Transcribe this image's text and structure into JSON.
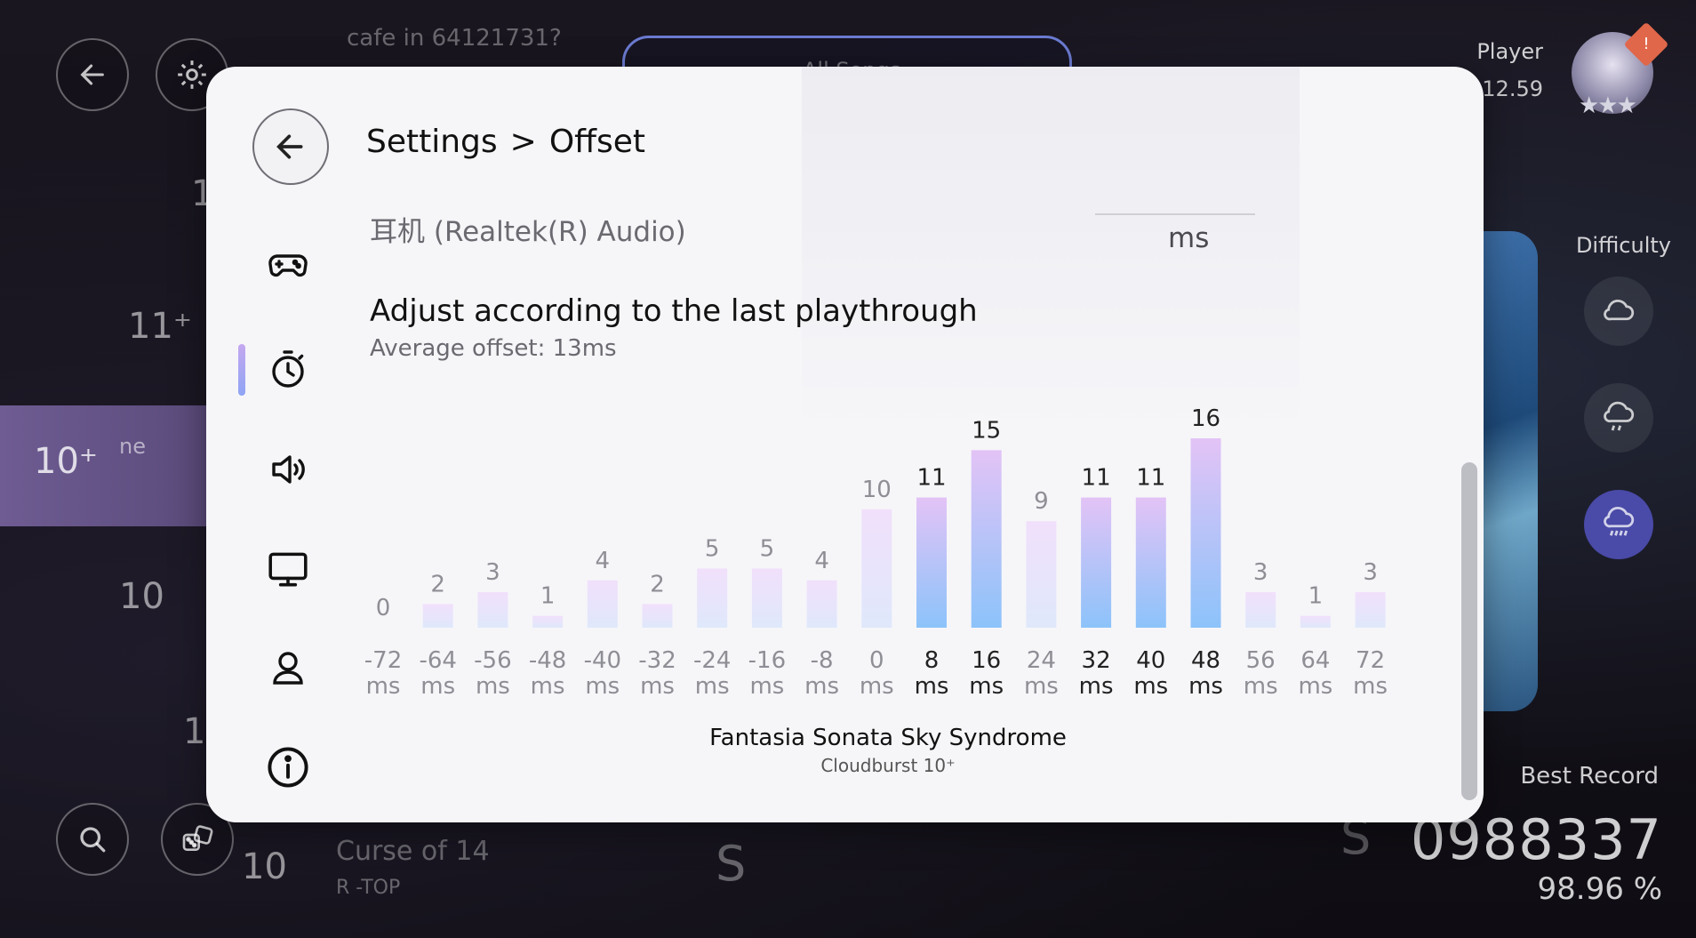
{
  "background": {
    "song_header_text": "cafe in 64121731?",
    "pill_label": "All Songs",
    "level_labels": [
      "1",
      "11⁺",
      "10⁺",
      "10",
      "1",
      "10"
    ],
    "list_item_text": "ne",
    "bottom_song_title": "Curse of 14",
    "bottom_song_sub": "R -TOP",
    "s_marks": [
      "S",
      "S"
    ]
  },
  "player": {
    "name": "Player",
    "rks": "12.59",
    "badge": "!",
    "stars": "★★★"
  },
  "difficulty": {
    "label": "Difficulty",
    "icons": [
      "cloud-icon",
      "cloud-drizzle-icon",
      "cloud-rain-icon"
    ],
    "active_index": 2
  },
  "best_record": {
    "label": "Best Record",
    "score": "0988337",
    "accuracy": "98.96 %"
  },
  "modal": {
    "breadcrumb": {
      "parent": "Settings",
      "separator": ">",
      "current": "Offset"
    },
    "device": "耳机 (Realtek(R) Audio)",
    "ms_unit": "ms",
    "adjust_title": "Adjust according to the last playthrough",
    "average_offset": "Average offset: 13ms",
    "song_title": "Fantasia Sonata Sky Syndrome",
    "song_difficulty": "Cloudburst 10⁺",
    "nav_icons": [
      "gamepad-icon",
      "stopwatch-icon",
      "speaker-icon",
      "monitor-icon",
      "user-icon",
      "info-icon"
    ],
    "active_nav_index": 1
  },
  "chart_data": {
    "type": "bar",
    "categories": [
      "-72",
      "-64",
      "-56",
      "-48",
      "-40",
      "-32",
      "-24",
      "-16",
      "-8",
      "0",
      "8",
      "16",
      "24",
      "32",
      "40",
      "48",
      "56",
      "64",
      "72"
    ],
    "unit": "ms",
    "values": [
      0,
      2,
      3,
      1,
      4,
      2,
      5,
      5,
      4,
      10,
      11,
      15,
      9,
      11,
      11,
      16,
      3,
      1,
      3
    ],
    "highlighted": [
      10,
      11,
      13,
      14,
      15
    ],
    "ylim": [
      0,
      16
    ]
  }
}
